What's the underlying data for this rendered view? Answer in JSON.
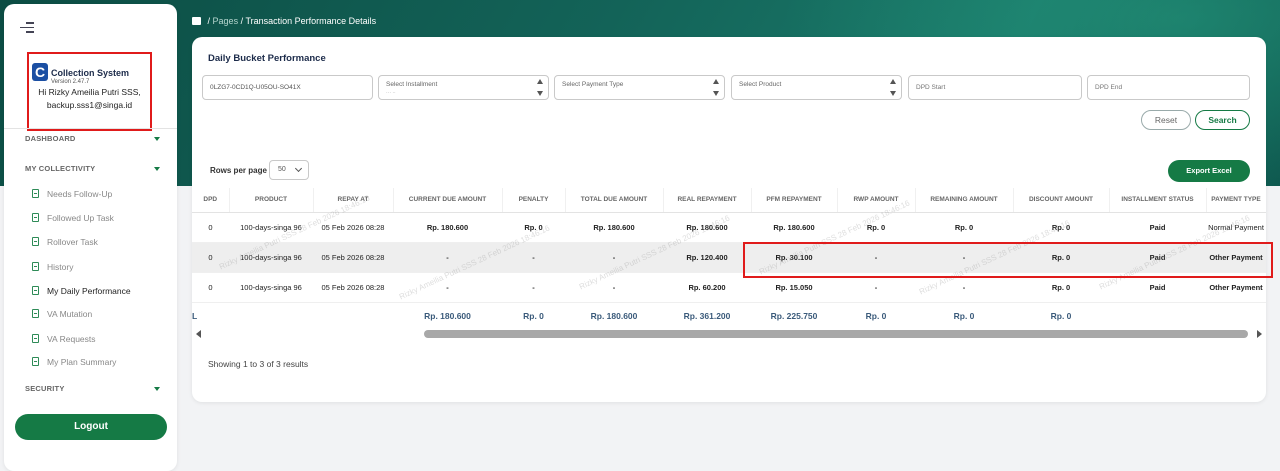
{
  "sidebar": {
    "app_title": "Collection System",
    "app_version": "Version 2.47.7",
    "logo_letter": "C",
    "greeting": "Hi Rizky Ameilia Putri SSS,",
    "email": "backup.sss1@singa.id",
    "sections": {
      "dashboard": "DASHBOARD",
      "my_collectivity": "MY COLLECTIVITY",
      "security": "SECURITY"
    },
    "items": [
      {
        "label": "Needs Follow-Up"
      },
      {
        "label": "Followed Up Task"
      },
      {
        "label": "Rollover Task"
      },
      {
        "label": "History"
      },
      {
        "label": "My Daily Performance"
      },
      {
        "label": "VA Mutation"
      },
      {
        "label": "VA Requests"
      },
      {
        "label": "My Plan Summary"
      }
    ],
    "logout_label": "Logout"
  },
  "breadcrumb": {
    "pages": "Pages",
    "separator": "/",
    "current": "Transaction Performance Details"
  },
  "card": {
    "title": "Daily Bucket Performance"
  },
  "filters": {
    "id_value": "0LZG7-0CD1Q-U05OU-SO41X",
    "installment_placeholder": "Select Installment",
    "payment_type_placeholder": "Select Payment Type",
    "product_placeholder": "Select Product",
    "dpd_start_placeholder": "DPD Start",
    "dpd_end_placeholder": "DPD End"
  },
  "actions": {
    "reset_label": "Reset",
    "search_label": "Search",
    "export_label": "Export Excel",
    "rows_per_page_label": "Rows per page",
    "rows_per_page_value": "50"
  },
  "table": {
    "columns": [
      "DPD",
      "PRODUCT",
      "REPAY AT",
      "CURRENT DUE AMOUNT",
      "PENALTY",
      "TOTAL DUE AMOUNT",
      "REAL REPAYMENT",
      "PFM REPAYMENT",
      "RWP AMOUNT",
      "REMAINING AMOUNT",
      "DISCOUNT AMOUNT",
      "INSTALLMENT STATUS",
      "PAYMENT TYPE"
    ],
    "rows": [
      [
        "0",
        "100-days-singa 96",
        "05 Feb 2026 08:28",
        "Rp. 180.600",
        "Rp. 0",
        "Rp. 180.600",
        "Rp. 180.600",
        "Rp. 180.600",
        "Rp. 0",
        "Rp. 0",
        "Rp. 0",
        "Paid",
        "Normal Payment"
      ],
      [
        "0",
        "100-days-singa 96",
        "05 Feb 2026 08:28",
        "-",
        "-",
        "-",
        "Rp. 120.400",
        "Rp. 30.100",
        "-",
        "-",
        "Rp. 0",
        "Paid",
        "Other Payment"
      ],
      [
        "0",
        "100-days-singa 96",
        "05 Feb 2026 08:28",
        "-",
        "-",
        "-",
        "Rp. 60.200",
        "Rp. 15.050",
        "-",
        "-",
        "Rp. 0",
        "Paid",
        "Other Payment"
      ]
    ],
    "total_label": "L",
    "totals": [
      "Rp. 180.600",
      "Rp. 0",
      "Rp. 180.600",
      "Rp. 361.200",
      "Rp. 225.750",
      "Rp. 0",
      "Rp. 0",
      "Rp. 0"
    ],
    "watermark": "Rizky Ameilia Putri SSS 28 Feb 2026 18:46:16"
  },
  "pagination": {
    "showing": "Showing 1 to 3 of 3 results"
  },
  "colors": {
    "brand_green": "#157a45",
    "header_teal": "#136358",
    "highlight_red": "#e01b1b"
  }
}
